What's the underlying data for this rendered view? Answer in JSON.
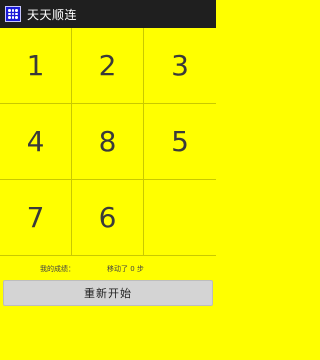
{
  "app": {
    "title": "天天顺连",
    "icon": "grid-dots-icon"
  },
  "board": {
    "tiles": [
      "1",
      "2",
      "3",
      "4",
      "8",
      "5",
      "7",
      "6",
      ""
    ]
  },
  "status": {
    "score_label": "我的成绩：",
    "moves_text": "移动了 0 步"
  },
  "controls": {
    "restart_label": "重新开始"
  },
  "colors": {
    "background": "#ffff00",
    "titlebar": "#1f1f1f",
    "button": "#d4d4d4"
  }
}
